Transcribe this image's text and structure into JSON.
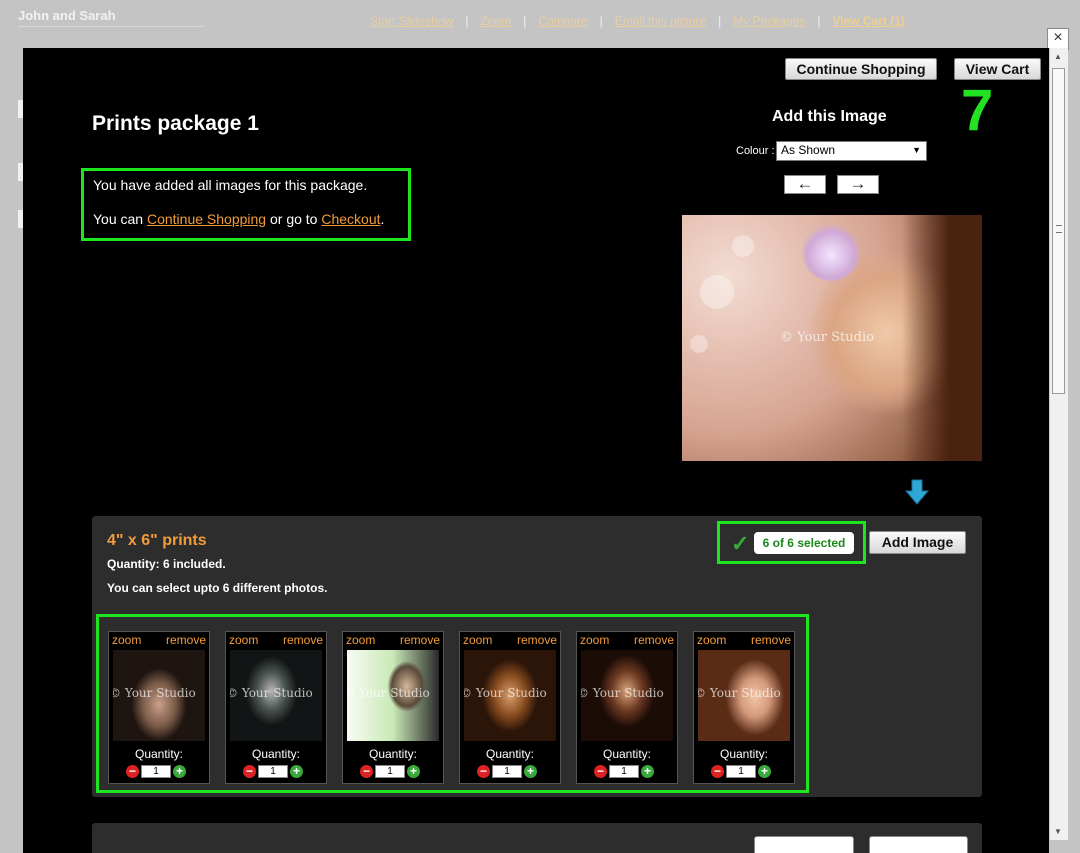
{
  "background": {
    "title": "John and Sarah",
    "nav": [
      "Start Slideshow",
      "Zoom",
      "Compare",
      "Email this picture",
      "My Packages",
      "View Cart (1)"
    ]
  },
  "modal": {
    "close_icon": "×",
    "continue_shopping_label": "Continue Shopping",
    "view_cart_label": "View Cart",
    "package_title": "Prints package 1",
    "info": {
      "line1": "You have added all images for this package.",
      "prefix": "You can ",
      "continue_link": "Continue Shopping",
      "middle": " or go to ",
      "checkout_link": "Checkout",
      "suffix": "."
    },
    "add_image_title": "Add this Image",
    "step_number": "7",
    "colour_label": "Colour :",
    "colour_value": "As Shown",
    "prev_arrow": "←",
    "next_arrow": "→",
    "watermark": "© Your Studio",
    "panel": {
      "title": "4\" x 6\" prints",
      "quantity_text": "Quantity: 6 included.",
      "upto_text": "You can select upto 6 different photos.",
      "selected_badge": "6 of 6 selected",
      "check_icon": "✓",
      "add_image_label": "Add Image",
      "thumbs": [
        {
          "zoom": "zoom",
          "remove": "remove",
          "quantity_label": "Quantity:",
          "qty": "1",
          "watermark": "© Your Studio"
        },
        {
          "zoom": "zoom",
          "remove": "remove",
          "quantity_label": "Quantity:",
          "qty": "1",
          "watermark": "© Your Studio"
        },
        {
          "zoom": "zoom",
          "remove": "remove",
          "quantity_label": "Quantity:",
          "qty": "1",
          "watermark": "© Your Studio"
        },
        {
          "zoom": "zoom",
          "remove": "remove",
          "quantity_label": "Quantity:",
          "qty": "1",
          "watermark": "© Your Studio"
        },
        {
          "zoom": "zoom",
          "remove": "remove",
          "quantity_label": "Quantity:",
          "qty": "1",
          "watermark": "© Your Studio"
        },
        {
          "zoom": "zoom",
          "remove": "remove",
          "quantity_label": "Quantity:",
          "qty": "1",
          "watermark": "© Your Studio"
        }
      ]
    }
  },
  "colors": {
    "accent_orange": "#f39c3a",
    "highlight_green": "#1ee61e",
    "modal_bg": "#000000",
    "panel_bg": "#2d2d2d"
  }
}
